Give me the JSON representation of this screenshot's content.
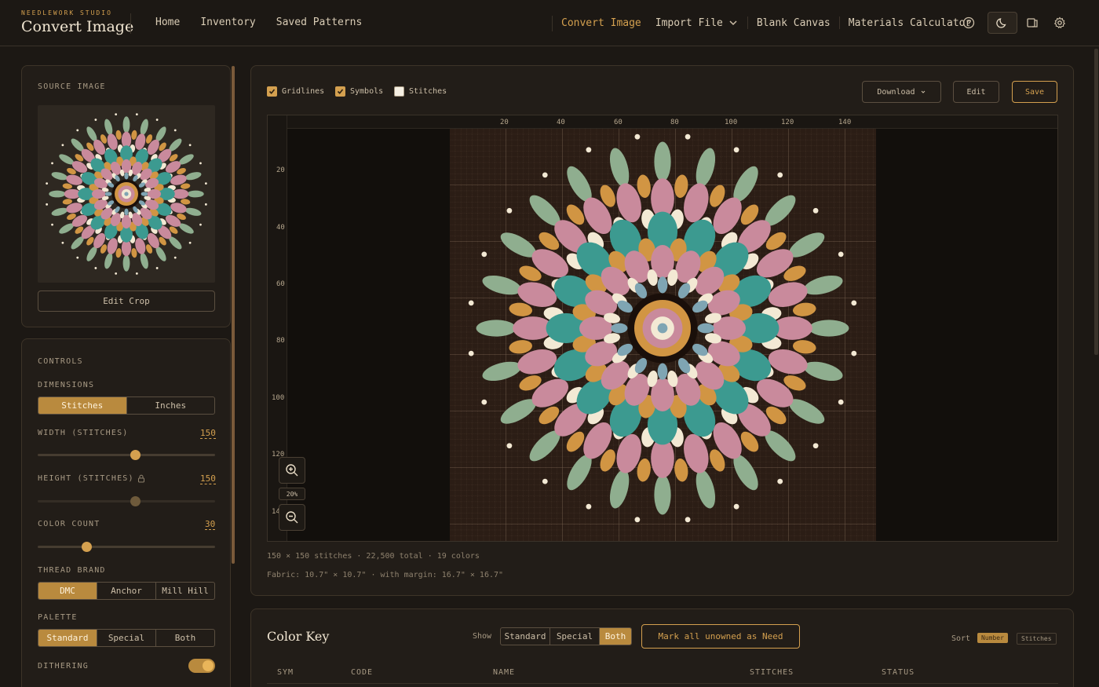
{
  "header": {
    "brand_small": "NEEDLEWORK STUDIO",
    "brand_title": "Convert Image",
    "nav_left": [
      "Home",
      "Inventory",
      "Saved Patterns"
    ],
    "nav_convert": "Convert Image",
    "nav_import": "Import File",
    "nav_blank": "Blank Canvas",
    "nav_materials": "Materials Calculator"
  },
  "source": {
    "title": "SOURCE IMAGE",
    "edit_crop": "Edit Crop"
  },
  "controls": {
    "title": "CONTROLS",
    "dimensions_label": "DIMENSIONS",
    "dimension_options": [
      "Stitches",
      "Inches"
    ],
    "dimension_selected": "Stitches",
    "width_label": "WIDTH (STITCHES)",
    "width_value": "150",
    "width_fraction": 0.58,
    "height_label": "HEIGHT (STITCHES)",
    "height_value": "150",
    "height_fraction": 0.58,
    "color_count_label": "COLOR COUNT",
    "color_count_value": "30",
    "color_count_fraction": 0.27,
    "thread_brand_label": "THREAD BRAND",
    "thread_brands": [
      "DMC",
      "Anchor",
      "Mill Hill"
    ],
    "thread_selected": "DMC",
    "palette_label": "PALETTE",
    "palettes": [
      "Standard",
      "Special",
      "Both"
    ],
    "palette_selected": "Standard",
    "dithering_label": "DITHERING",
    "dithering_on": true
  },
  "toolbar": {
    "gridlines": "Gridlines",
    "gridlines_checked": true,
    "symbols": "Symbols",
    "symbols_checked": true,
    "stitches": "Stitches",
    "stitches_checked": false,
    "download": "Download",
    "edit": "Edit",
    "save": "Save"
  },
  "canvas": {
    "ruler_top": [
      "20",
      "40",
      "60",
      "80",
      "100",
      "120",
      "140"
    ],
    "ruler_left": [
      "20",
      "40",
      "60",
      "80",
      "100",
      "120",
      "14"
    ],
    "zoom": "20%",
    "colors": {
      "background": "#2b1d15",
      "green": "#8fae8f",
      "pink": "#c98a9c",
      "teal": "#3c9a90",
      "orange": "#d19543",
      "cream": "#f3e9d4",
      "blue": "#7fa5b3"
    }
  },
  "stats": {
    "line1": "150 × 150 stitches · 22,500 total · 19 colors",
    "line2": "Fabric: 10.7\" × 10.7\" · with margin: 16.7\" × 16.7\""
  },
  "color_key": {
    "title": "Color Key",
    "show_label": "Show",
    "show_options": [
      "Standard",
      "Special",
      "Both"
    ],
    "show_selected": "Both",
    "mark_button": "Mark all unowned as Need",
    "sort_label": "Sort",
    "sort_options": [
      "Number",
      "Stitches"
    ],
    "sort_selected": "Number",
    "columns": [
      "SYM",
      "CODE",
      "NAME",
      "STITCHES",
      "STATUS"
    ]
  }
}
